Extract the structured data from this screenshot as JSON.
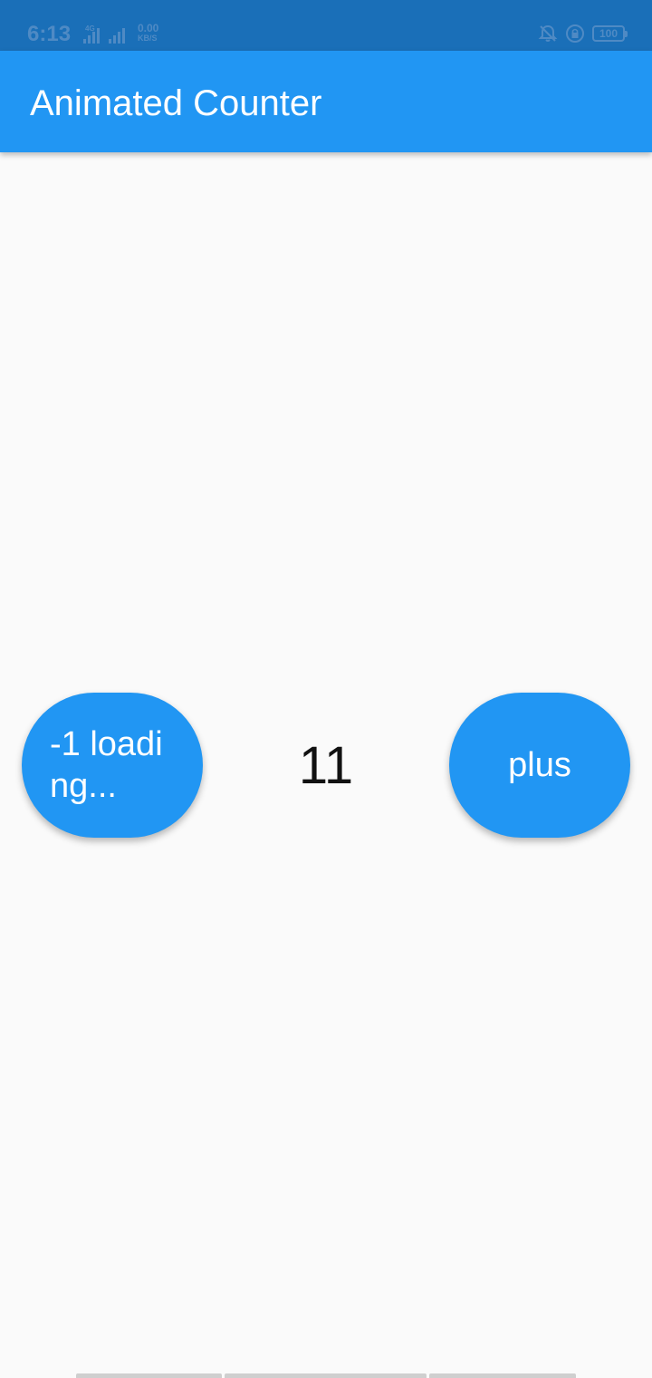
{
  "status_bar": {
    "time": "6:13",
    "network_type": "4G",
    "speed_value": "0.00",
    "speed_unit": "KB/S",
    "battery": "100",
    "icons": [
      "signal-4g-icon",
      "signal-icon",
      "bell-off-icon",
      "rotation-lock-icon",
      "battery-icon"
    ]
  },
  "app_bar": {
    "title": "Animated Counter"
  },
  "counter": {
    "value": "11"
  },
  "buttons": {
    "decrement_label": "-1 loading...",
    "increment_label": "plus"
  },
  "colors": {
    "primary": "#2196f3",
    "status_bar": "#1a6fb8",
    "background": "#fafafa",
    "text_on_primary": "#ffffff",
    "counter_text": "#111111"
  }
}
